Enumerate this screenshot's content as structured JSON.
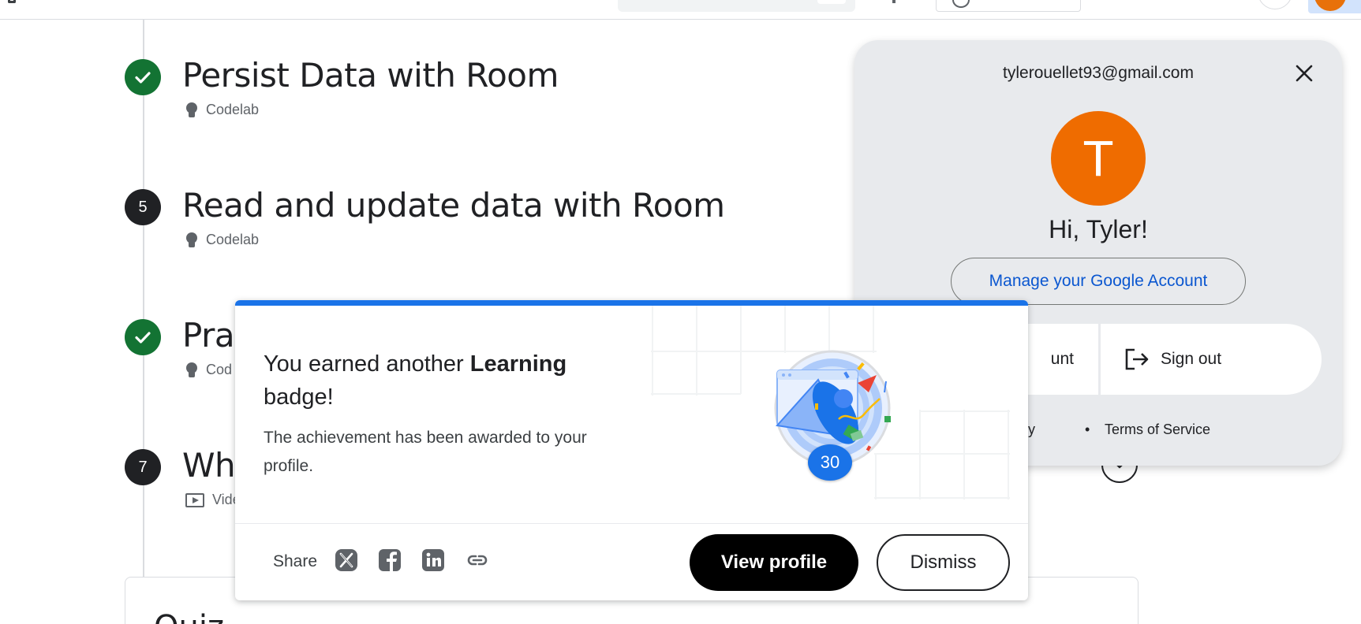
{
  "steps": [
    {
      "status": "done",
      "number": "",
      "title": "Persist Data with Room",
      "type": "Codelab",
      "icon": "lightbulb-icon"
    },
    {
      "status": "todo",
      "number": "5",
      "title": "Read and update data with Room",
      "type": "Codelab",
      "icon": "lightbulb-icon"
    },
    {
      "status": "done",
      "number": "",
      "title": "Prac",
      "type": "Cod",
      "icon": "lightbulb-icon"
    },
    {
      "status": "todo",
      "number": "7",
      "title": "Wh",
      "type": "Vide",
      "icon": "video-icon"
    }
  ],
  "quiz": {
    "title": "Quiz"
  },
  "account": {
    "email": "tylerouellet93@gmail.com",
    "avatar_letter": "T",
    "greeting": "Hi, Tyler!",
    "manage_label": "Manage your Google Account",
    "add_label": "unt",
    "signout_label": "Sign out",
    "privacy_label": "r Policy",
    "separator": "•",
    "terms_label": "Terms of Service",
    "avatar_color": "#ef6c00"
  },
  "badge_dialog": {
    "heading_prefix": "You earned another ",
    "heading_bold": "Learning",
    "heading_suffix": " badge!",
    "body": "The achievement has been awarded to your profile.",
    "badge_count": "30",
    "share_label": "Share",
    "share_icons": [
      "x-icon",
      "facebook-icon",
      "linkedin-icon",
      "link-icon"
    ],
    "view_profile_label": "View profile",
    "dismiss_label": "Dismiss",
    "accent_color": "#1a73e8"
  }
}
